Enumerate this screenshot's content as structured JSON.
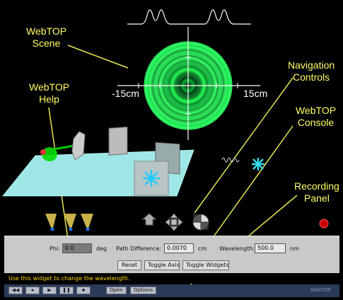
{
  "callouts": {
    "scene": [
      "WebTOP",
      "Scene"
    ],
    "help": [
      "WebTOP",
      "Help"
    ],
    "navigation": [
      "Navigation",
      "Controls"
    ],
    "console": [
      "WebTOP",
      "Console"
    ],
    "recording": [
      "Recording",
      "Panel"
    ]
  },
  "screen": {
    "axis_left_label": "-15cm",
    "axis_right_label": "15cm"
  },
  "navigation_icons": [
    "elevate-icon",
    "pan-icon",
    "examine-icon"
  ],
  "console": {
    "phi_label": "Phi:",
    "phi_value": "0.0",
    "phi_unit": "deg",
    "path_difference_label": "Path Difference:",
    "path_difference_value": "0.0070",
    "path_difference_unit": "cm",
    "wavelength_label": "Wavelength:",
    "wavelength_value": "500.0",
    "wavelength_unit": "nm",
    "reset_label": "Reset",
    "toggle_axis_label": "Toggle Axis",
    "toggle_widgets_label": "Toggle Widgets",
    "help_text": "Use this widget to change the wavelength."
  },
  "recording": {
    "buttons": [
      "rewind-icon",
      "record-icon",
      "play-icon",
      "pause-icon",
      "stop-icon"
    ],
    "open_label": "Open",
    "options_label": "Options",
    "brand": "WebTOP"
  },
  "colors": {
    "callout": "#ffff66",
    "rings": "#22ff55",
    "table": "#9fe6e6",
    "console_bg": "#c9c9c9",
    "help_text": "#ffd700",
    "recording_bg": "#2c3a5a"
  }
}
